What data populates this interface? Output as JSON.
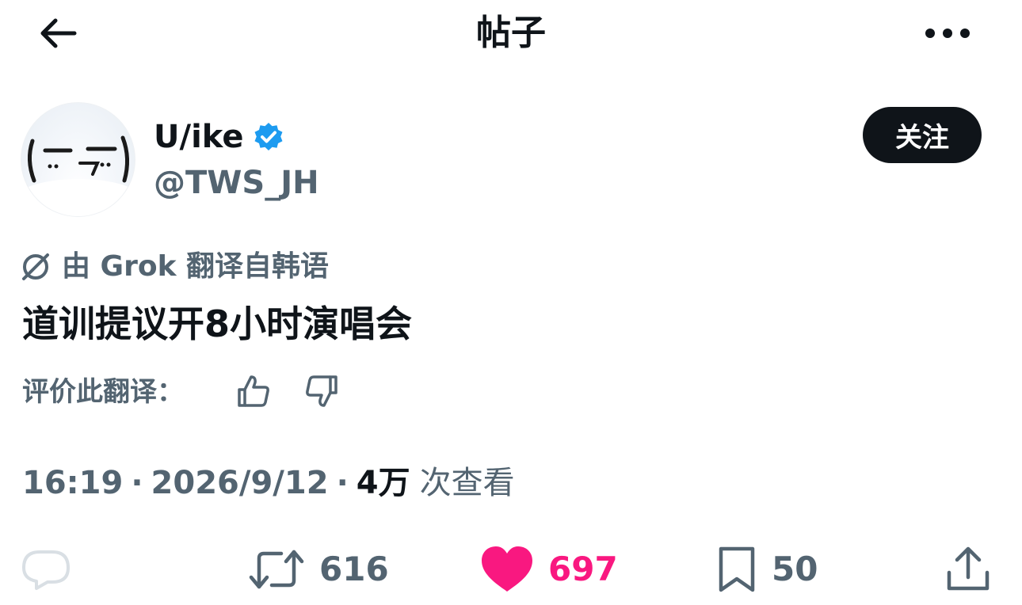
{
  "header": {
    "title": "帖子",
    "back_icon": "arrow-left-icon",
    "more_icon": "more-horizontal-icon"
  },
  "author": {
    "display_name": "U/ike",
    "handle": "@TWS_JH",
    "verified_icon": "verified-badge-icon",
    "follow_label": "关注",
    "avatar_text": "(-.- )"
  },
  "translation": {
    "icon": "grok-icon",
    "label": "由 Grok 翻译自韩语",
    "rate_label": "评价此翻译：",
    "thumb_up_icon": "thumbs-up-icon",
    "thumb_down_icon": "thumbs-down-icon"
  },
  "tweet": {
    "text": "道训提议开8小时演唱会"
  },
  "meta": {
    "time": "16:19",
    "date": "2026/9/12",
    "views_count": "4万",
    "views_label": "次查看",
    "separator": "·"
  },
  "actions": {
    "reply": {
      "icon": "reply-icon",
      "count": ""
    },
    "retweet": {
      "icon": "retweet-icon",
      "count": "616"
    },
    "like": {
      "icon": "heart-filled-icon",
      "count": "697"
    },
    "bookmark": {
      "icon": "bookmark-icon",
      "count": "50"
    },
    "share": {
      "icon": "share-icon"
    }
  },
  "colors": {
    "text_primary": "#0f1419",
    "text_secondary": "#536471",
    "like": "#f91880",
    "verified": "#1d9bf0",
    "follow_bg": "#0f1419"
  }
}
